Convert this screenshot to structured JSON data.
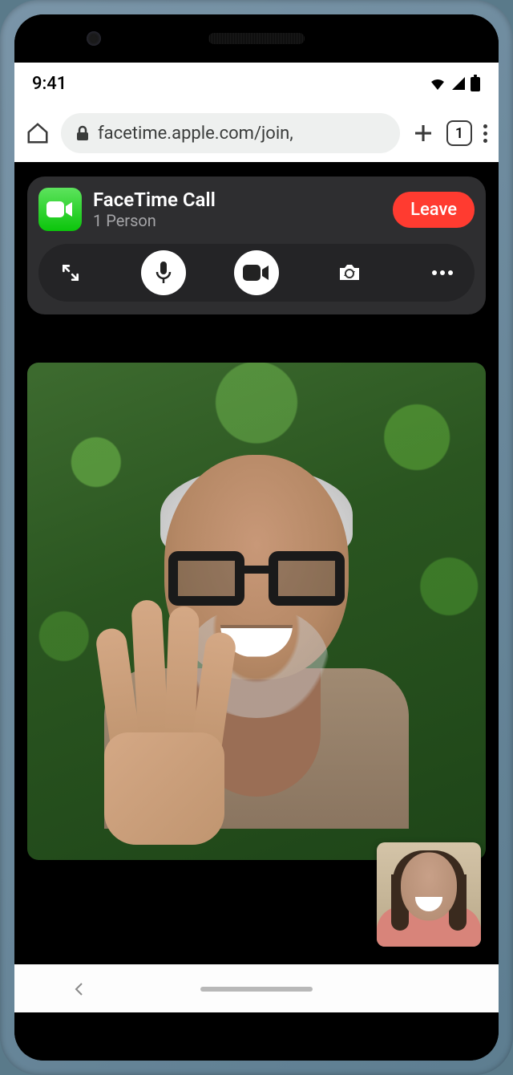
{
  "status": {
    "time": "9:41"
  },
  "browser": {
    "url": "facetime.apple.com/join,",
    "tab_count": "1"
  },
  "call": {
    "app_name": "FaceTime",
    "title": "FaceTime Call",
    "subtitle": "1 Person",
    "leave_label": "Leave"
  },
  "controls": {
    "expand": "expand",
    "mic": "microphone",
    "camera": "camera",
    "flip": "flip-camera",
    "more": "more"
  }
}
